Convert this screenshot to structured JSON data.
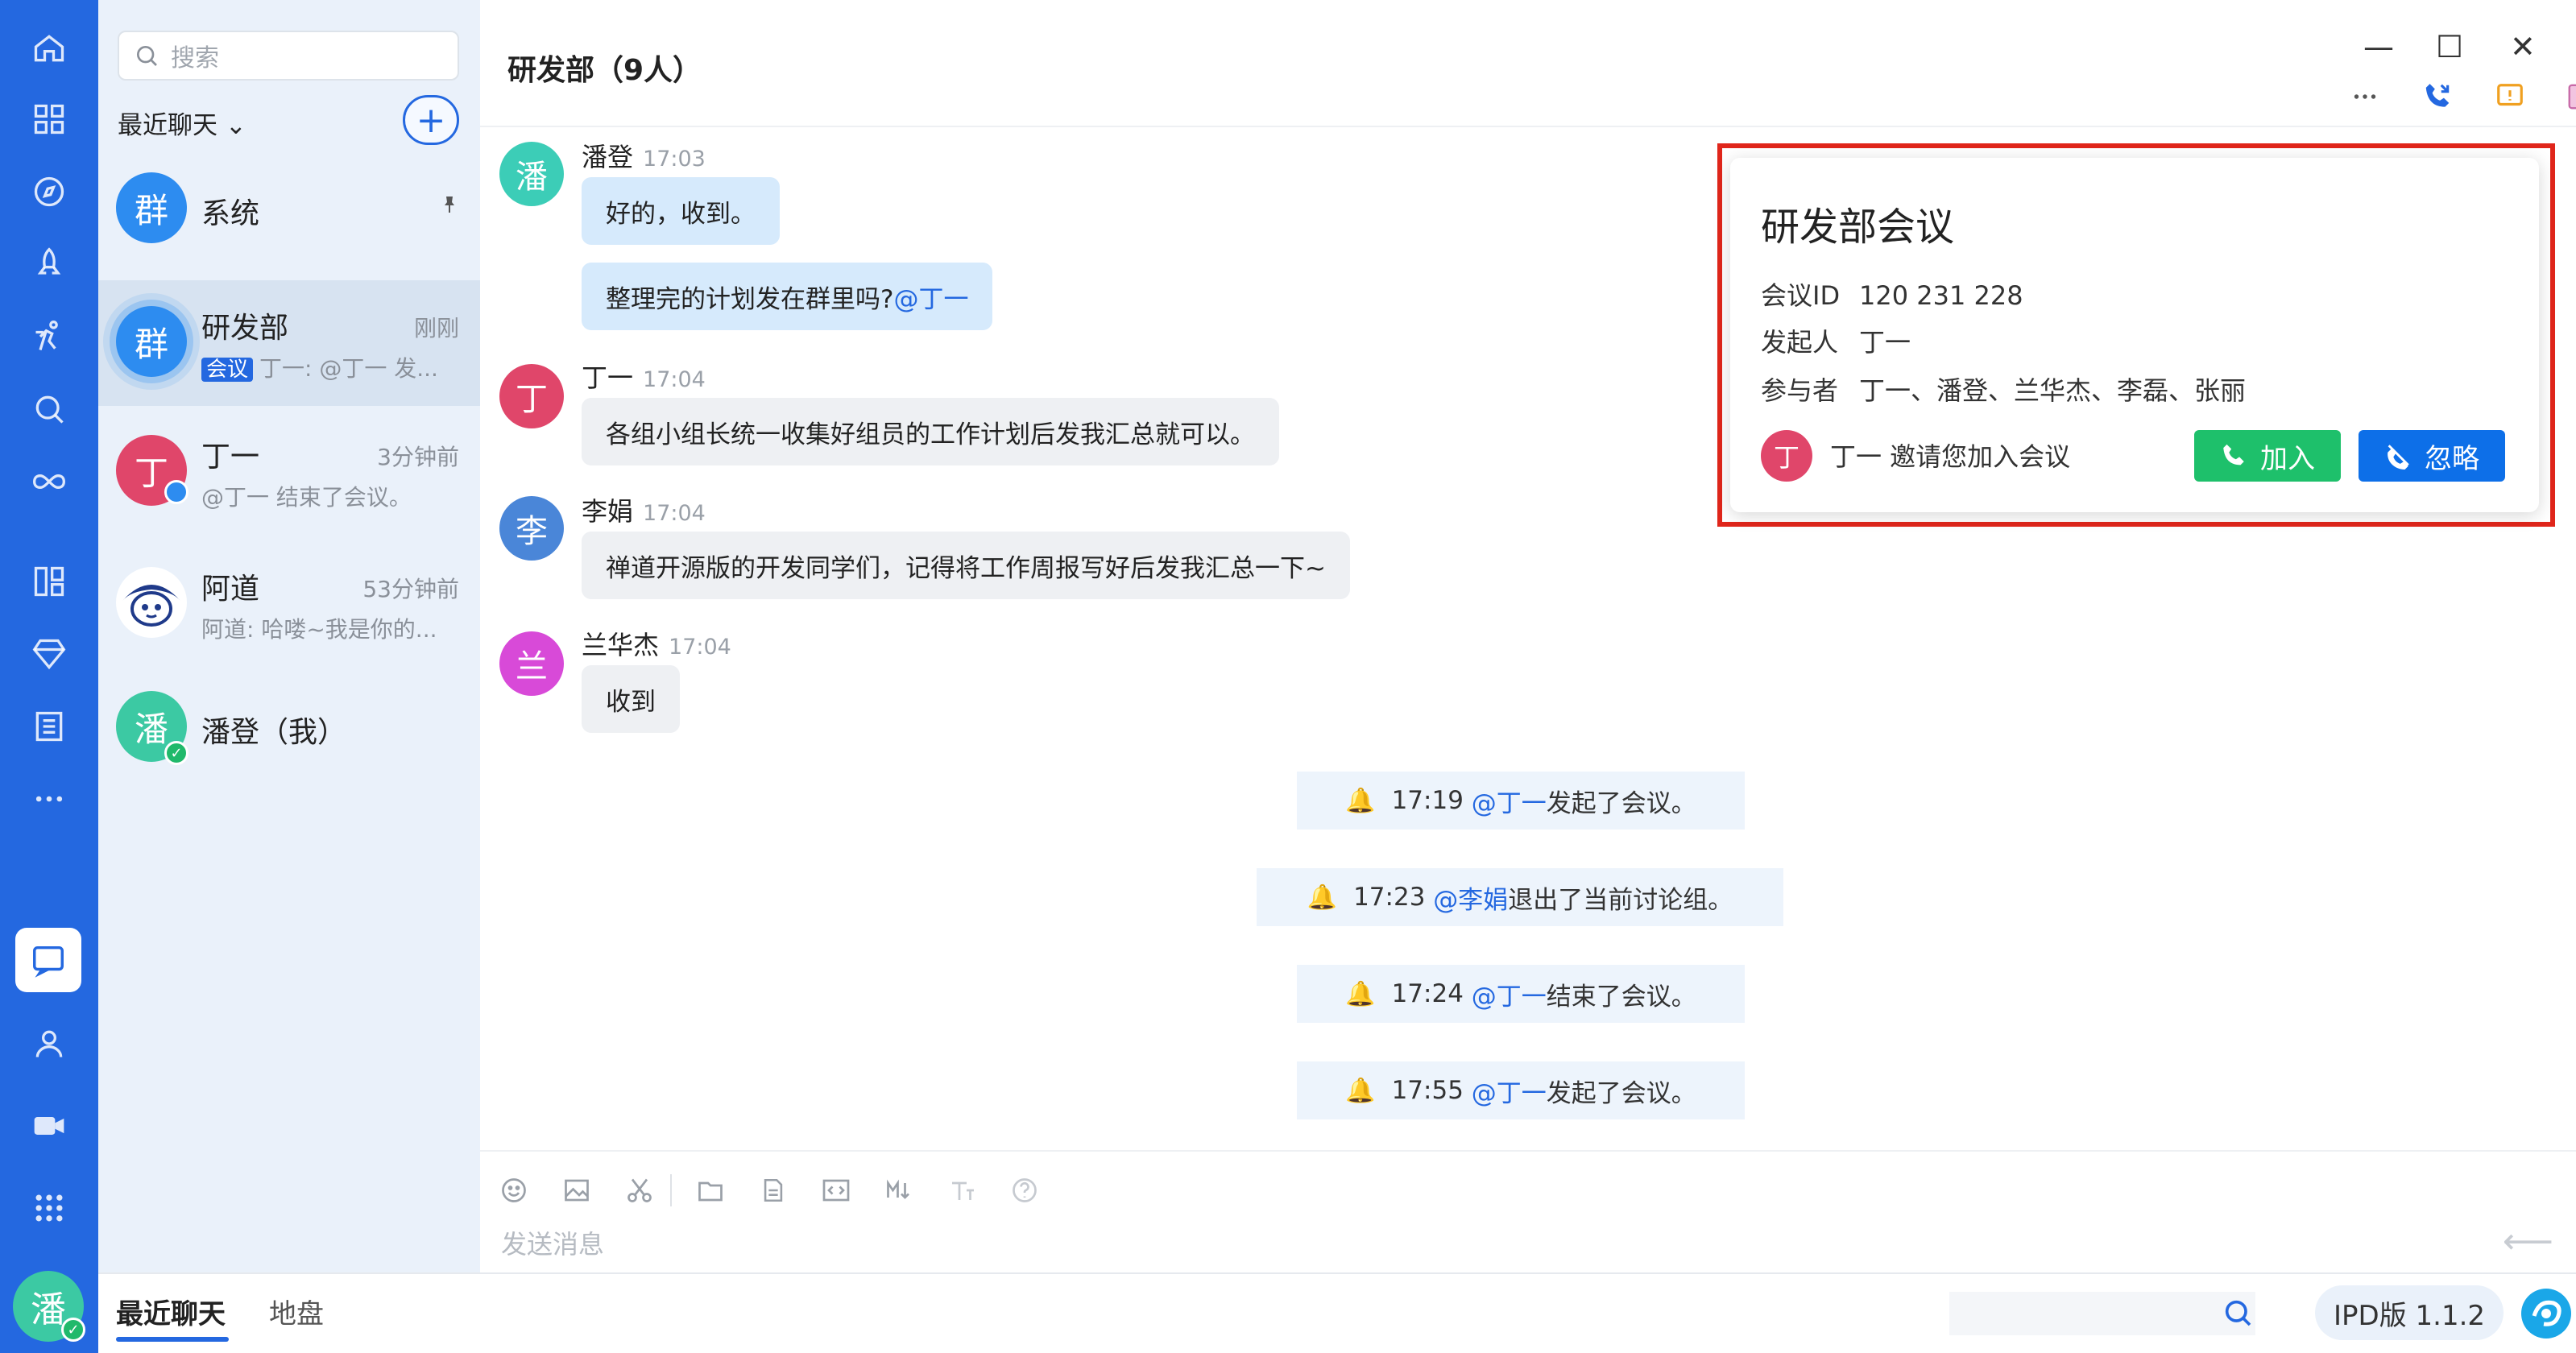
{
  "sidebar": {
    "nav_icons": [
      "home-icon",
      "apps-icon",
      "discover-icon",
      "rocket-icon",
      "run-icon",
      "search-icon",
      "infinity-icon",
      "layout-icon",
      "diamond-icon",
      "notes-icon",
      "more-icon",
      "chat-icon",
      "contact-icon",
      "video-icon",
      "grid-icon"
    ],
    "active_item": "chat",
    "user_avatar": "潘"
  },
  "conversation_list": {
    "search_placeholder": "搜索",
    "recent_label": "最近聊天",
    "recent_chevron": "⌄",
    "add_label": "+",
    "items": [
      {
        "avatar": "群",
        "name": "系统",
        "time": "",
        "preview": "",
        "pinned": true,
        "avatar_color": "#2d8cf0"
      },
      {
        "avatar": "群",
        "name": "研发部",
        "time": "刚刚",
        "tag": "会议",
        "preview": "丁一: @丁一 发...",
        "active": true,
        "avatar_color": "#2d8cf0"
      },
      {
        "avatar": "丁",
        "name": "丁一",
        "time": "3分钟前",
        "preview": "@丁一 结束了会议。",
        "avatar_color": "#e0466a"
      },
      {
        "avatar": "",
        "name": "阿道",
        "time": "53分钟前",
        "preview": "阿道: 哈喽~我是你的...",
        "avatar_color": "#ffffff"
      },
      {
        "avatar": "潘",
        "name": "潘登（我）",
        "time": "",
        "preview": "",
        "avatar_color": "#3cc9a3"
      }
    ]
  },
  "chat": {
    "title": "研发部（9人）",
    "window_controls": {
      "minimize": "—",
      "maximize": "☐",
      "close": "✕"
    },
    "tool_icons": [
      "more-icon",
      "phone-icon",
      "alert-icon",
      "panel-icon"
    ],
    "messages": [
      {
        "sender": "潘登",
        "time": "17:03",
        "avatar": "潘",
        "avatar_color": "#3ccdb7",
        "bubbles": [
          {
            "text": "好的，收到。",
            "style": "blue"
          },
          {
            "text": "整理完的计划发在群里吗?",
            "mention": "@丁一",
            "style": "blue"
          }
        ]
      },
      {
        "sender": "丁一",
        "time": "17:04",
        "avatar": "丁",
        "avatar_color": "#e0466a",
        "bubbles": [
          {
            "text": "各组小组长统一收集好组员的工作计划后发我汇总就可以。",
            "style": "gray"
          }
        ]
      },
      {
        "sender": "李娟",
        "time": "17:04",
        "avatar": "李",
        "avatar_color": "#4a86d8",
        "bubbles": [
          {
            "text": "禅道开源版的开发同学们，记得将工作周报写好后发我汇总一下~",
            "style": "gray"
          }
        ]
      },
      {
        "sender": "兰华杰",
        "time": "17:04",
        "avatar": "兰",
        "avatar_color": "#d84ad8",
        "bubbles": [
          {
            "text": "收到",
            "style": "gray"
          }
        ]
      }
    ],
    "system_messages": [
      {
        "time": "17:19",
        "mention": "@丁一",
        "text": " 发起了会议。"
      },
      {
        "time": "17:23",
        "mention": "@李娟",
        "text": " 退出了当前讨论组。"
      },
      {
        "time": "17:24",
        "mention": "@丁一",
        "text": " 结束了会议。"
      },
      {
        "time": "17:55",
        "mention": "@丁一",
        "text": " 发起了会议。"
      }
    ],
    "input": {
      "placeholder": "发送消息",
      "tools": [
        "emoji-icon",
        "image-icon",
        "scissors-icon",
        "folder-icon",
        "file-icon",
        "code-icon",
        "markdown-icon",
        "text-format-icon",
        "help-icon"
      ],
      "send_icon": "⟵"
    }
  },
  "meeting_card": {
    "title": "研发部会议",
    "id_label": "会议ID",
    "id_value": "120 231 228",
    "initiator_label": "发起人",
    "initiator_value": "丁一",
    "participants_label": "参与者",
    "participants_value": "丁一、潘登、兰华杰、李磊、张丽",
    "inviter_avatar": "丁",
    "invite_text": "丁一 邀请您加入会议",
    "join_label": "加入",
    "ignore_label": "忽略",
    "join_color": "#1ec06b",
    "ignore_color": "#0d6fe8"
  },
  "bottom_bar": {
    "tabs": [
      "最近聊天",
      "地盘"
    ],
    "active_tab": "最近聊天",
    "version": "IPD版 1.1.2"
  },
  "colors": {
    "accent": "#2468e0",
    "highlight_border": "#e0261b"
  }
}
